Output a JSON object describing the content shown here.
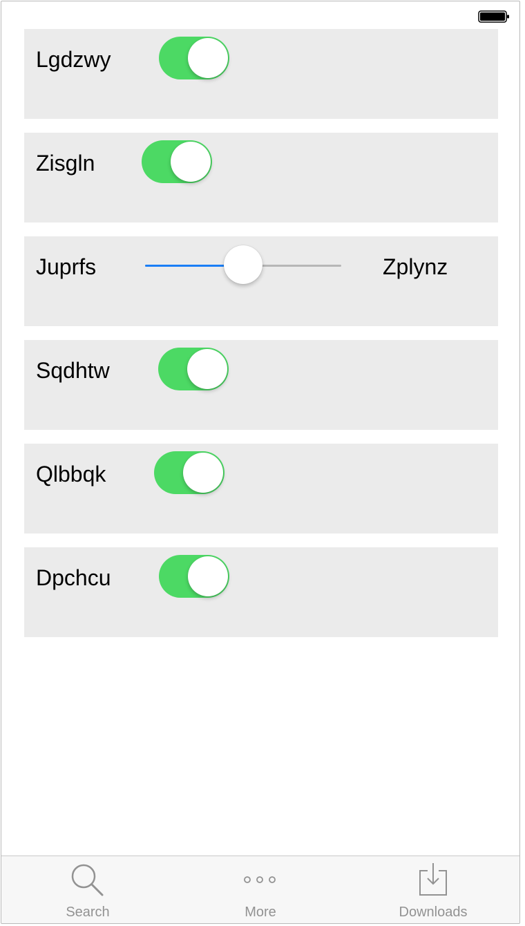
{
  "status_bar": {
    "battery_icon": "battery-full-icon"
  },
  "rows": [
    {
      "type": "toggle",
      "label": "Lgdzwy",
      "on": true
    },
    {
      "type": "toggle",
      "label": "Zisgln",
      "on": true
    },
    {
      "type": "slider",
      "label": "Juprfs",
      "right_label": "Zplynz",
      "value_fraction": 0.5
    },
    {
      "type": "toggle",
      "label": "Sqdhtw",
      "on": true
    },
    {
      "type": "toggle",
      "label": "Qlbbqk",
      "on": true
    },
    {
      "type": "toggle",
      "label": "Dpchcu",
      "on": true
    }
  ],
  "tab_bar": {
    "items": [
      {
        "label": "Search",
        "icon": "search-icon"
      },
      {
        "label": "More",
        "icon": "more-icon"
      },
      {
        "label": "Downloads",
        "icon": "downloads-icon"
      }
    ]
  },
  "colors": {
    "toggle_on": "#4cd964",
    "slider_min_track": "#1a7ef6",
    "slider_max_track": "#b6b6b6",
    "row_background": "#ebebeb",
    "tab_label": "#929292"
  }
}
